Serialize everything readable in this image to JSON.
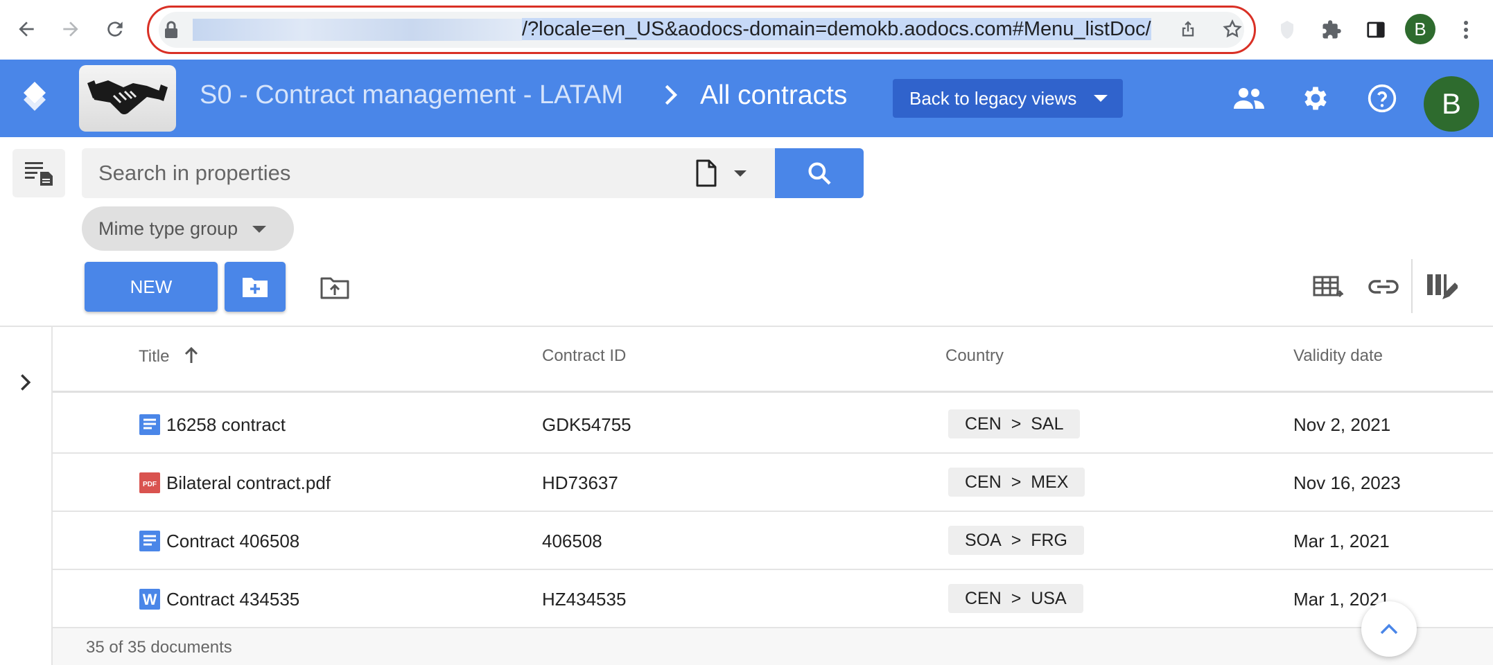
{
  "browser": {
    "url_visible": "/?locale=en_US&aodocs-domain=demokb.aodocs.com#Menu_listDoc/",
    "profile_initial": "B"
  },
  "header": {
    "library_name": "S0 - Contract management - LATAM",
    "breadcrumb_separator": ">",
    "view_name": "All contracts",
    "legacy_button": "Back to legacy views",
    "user_initial": "B",
    "brand_color": "#4a86e8"
  },
  "search": {
    "placeholder": "Search in properties"
  },
  "filters": {
    "mime_chip": "Mime type group"
  },
  "actions": {
    "new_label": "NEW"
  },
  "table": {
    "columns": [
      "Title",
      "Contract ID",
      "Country",
      "Validity date"
    ],
    "rows": [
      {
        "icon": "google-doc-icon",
        "title": "16258 contract",
        "contract_id": "GDK54755",
        "country_parent": "CEN",
        "country": "SAL",
        "validity": "Nov 2, 2021"
      },
      {
        "icon": "pdf-icon",
        "title": "Bilateral contract.pdf",
        "contract_id": "HD73637",
        "country_parent": "CEN",
        "country": "MEX",
        "validity": "Nov 16, 2023"
      },
      {
        "icon": "google-doc-icon",
        "title": "Contract 406508",
        "contract_id": "406508",
        "country_parent": "SOA",
        "country": "FRG",
        "validity": "Mar 1, 2021"
      },
      {
        "icon": "word-doc-icon",
        "title": "Contract 434535",
        "contract_id": "HZ434535",
        "country_parent": "CEN",
        "country": "USA",
        "validity": "Mar 1, 2021"
      }
    ],
    "tag_separator": ">",
    "footer": "35 of 35 documents"
  }
}
